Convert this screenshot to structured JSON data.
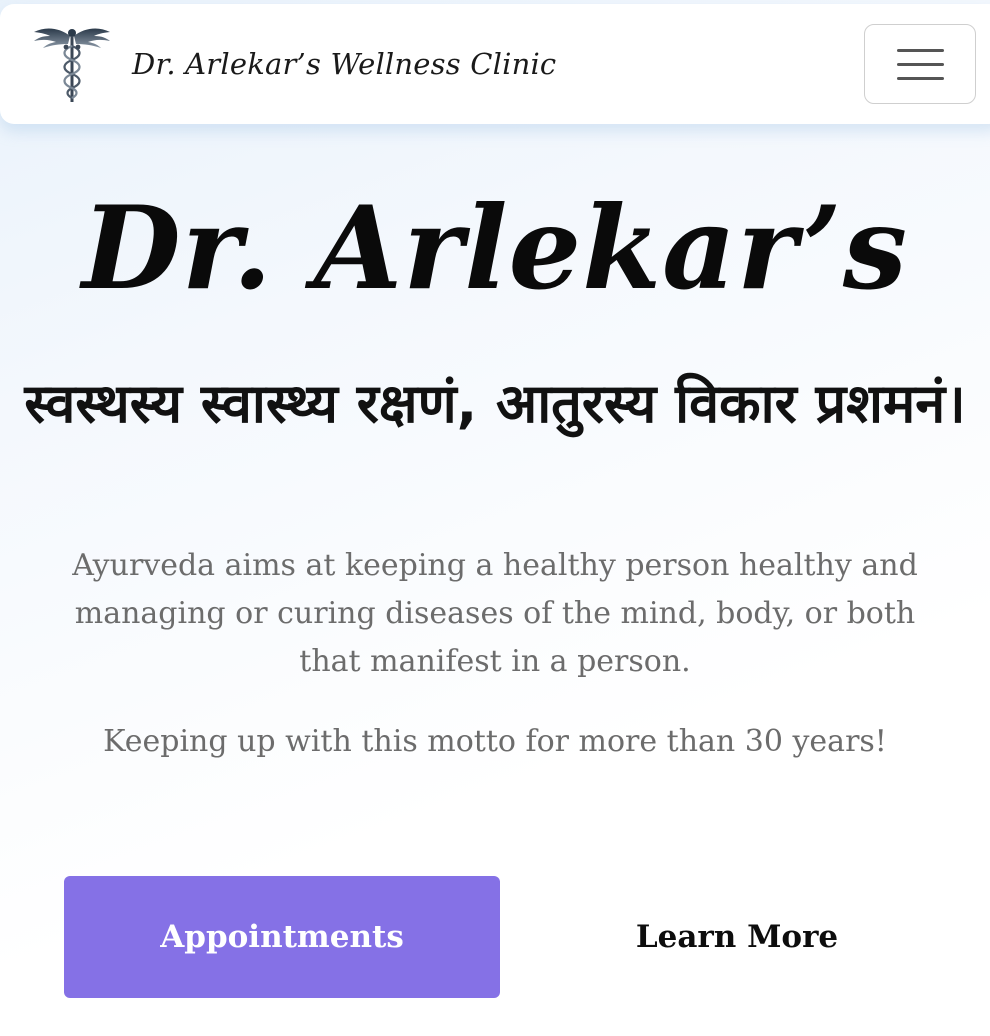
{
  "navbar": {
    "brand_name": "Dr. Arlekar’s Wellness Clinic",
    "logo_icon": "caduceus-icon",
    "menu_icon": "hamburger-menu-icon"
  },
  "hero": {
    "title": "Dr. Arlekar’s",
    "motto": "स्वस्थस्य स्वास्थ्य रक्षणं, आतुरस्य विकार प्रशमनं।",
    "description": "Ayurveda aims at keeping a healthy person healthy and managing or curing diseases of the mind, body, or both that manifest in a person.",
    "years_line": "Keeping up with this motto for more than 30 years!"
  },
  "actions": {
    "appointments_label": "Appointments",
    "learn_more_label": "Learn More"
  },
  "colors": {
    "primary_button": "#8571e6",
    "body_text": "#6c6c6c"
  }
}
